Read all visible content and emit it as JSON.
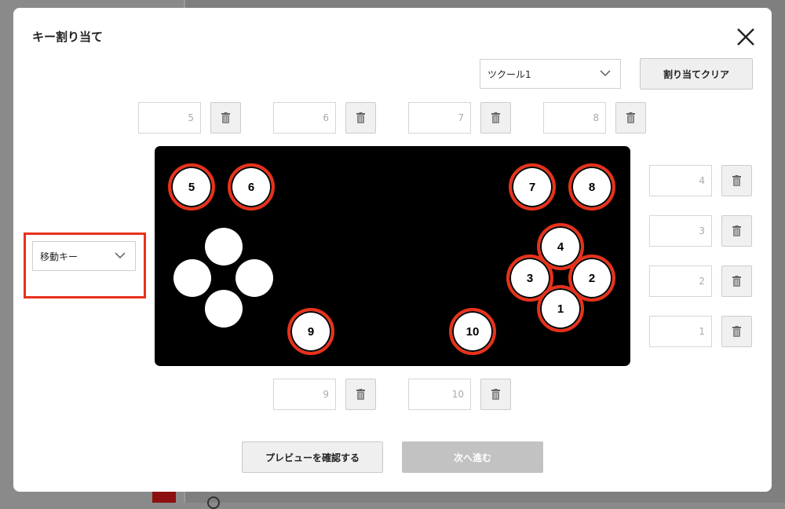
{
  "dialog": {
    "title": "キー割り当て"
  },
  "preset": {
    "value": "ツクール1"
  },
  "clear_button": "割り当てクリア",
  "mode_select": {
    "value": "移動キー"
  },
  "top_inputs": [
    "5",
    "6",
    "7",
    "8"
  ],
  "right_inputs": [
    "4",
    "3",
    "2",
    "1"
  ],
  "bottom_inputs": [
    "9",
    "10"
  ],
  "pad_buttons": {
    "b5": "5",
    "b6": "6",
    "b7": "7",
    "b8": "8",
    "b4": "4",
    "b3": "3",
    "b2": "2",
    "b1": "1",
    "b9": "9",
    "b10": "10"
  },
  "footer": {
    "preview_button": "プレビューを確認する",
    "next_button": "次へ進む"
  },
  "colors": {
    "accent_red": "#e8311a",
    "pad_bg": "#000000",
    "disabled_button": "#c2c2c2"
  },
  "icons": {
    "close": "close-icon",
    "chevron": "chevron-down-icon",
    "trash": "trash-icon"
  }
}
